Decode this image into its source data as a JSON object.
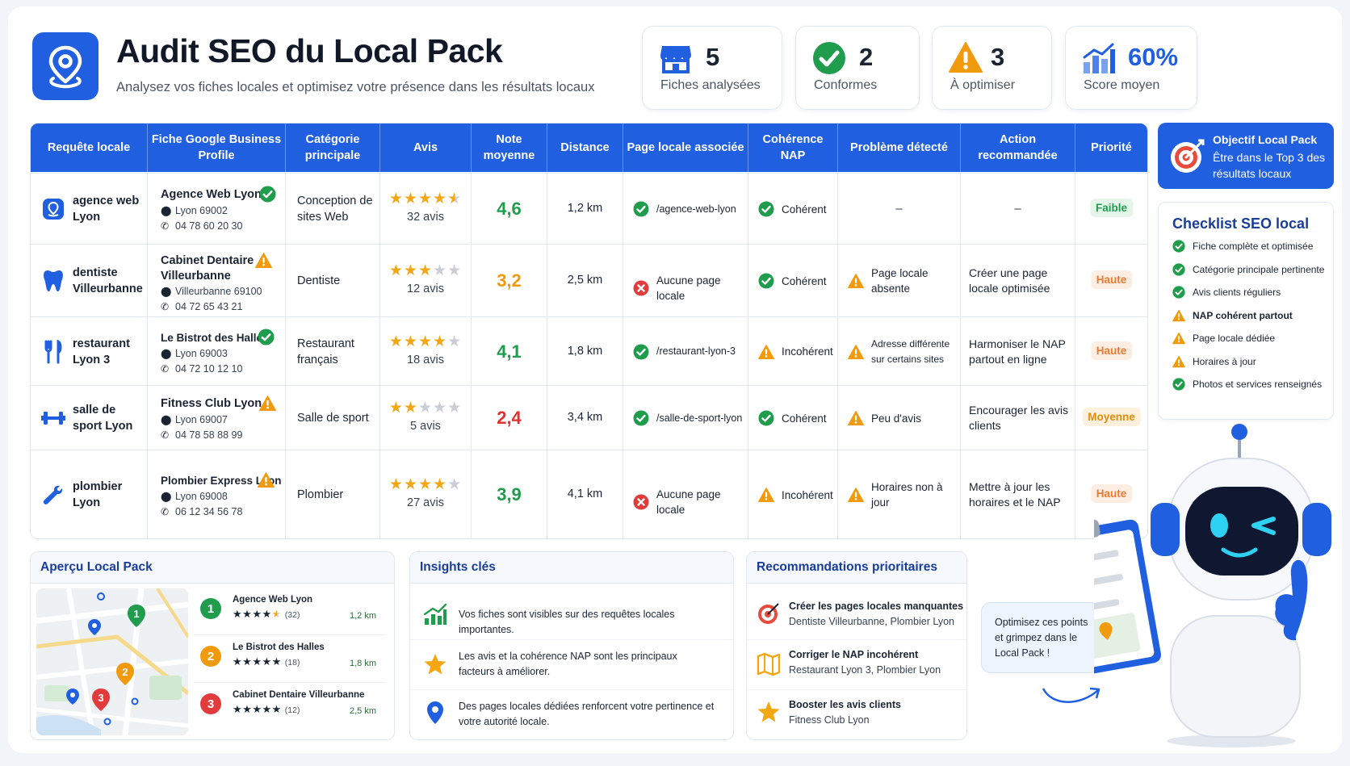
{
  "header": {
    "title": "Audit SEO du Local Pack",
    "subtitle": "Analysez vos fiches locales et optimisez votre présence dans les résultats locaux"
  },
  "kpis": [
    {
      "icon": "store-icon",
      "value": "5",
      "label": "Fiches analysées"
    },
    {
      "icon": "check-circle-icon",
      "value": "2",
      "label": "Conformes"
    },
    {
      "icon": "warning-icon",
      "value": "3",
      "label": "À optimiser"
    },
    {
      "icon": "bar-chart-icon",
      "value": "60%",
      "label": "Score moyen"
    }
  ],
  "table": {
    "headers": [
      "Requête locale",
      "Fiche Google Business Profile",
      "Catégorie principale",
      "Avis",
      "Note moyenne",
      "Distance",
      "Page locale associée",
      "Cohérence NAP",
      "Problème détecté",
      "Action recommandée",
      "Priorité"
    ],
    "rows": [
      {
        "query": "agence web Lyon",
        "query_icon": "location-badge-icon",
        "business": "Agence Web Lyon",
        "business_status": "ok",
        "city": "Lyon 69002",
        "phone": "04 78 60 20 30",
        "category": "Conception de sites Web",
        "rating_stars": 4.5,
        "reviews": "32 avis",
        "note": "4,6",
        "distance": "1,2 km",
        "page_status": "ok",
        "page": "/agence-web-lyon",
        "nap_status": "ok",
        "nap": "Cohérent",
        "problem_status": "none",
        "problem": "–",
        "action": "–",
        "priority": "Faible",
        "priority_level": "low"
      },
      {
        "query": "dentiste Villeurbanne",
        "query_icon": "tooth-icon",
        "business": "Cabinet Dentaire Villeurbanne",
        "business_status": "warn",
        "city": "Villeurbanne 69100",
        "phone": "04 72 65 43 21",
        "category": "Dentiste",
        "rating_stars": 3,
        "reviews": "12 avis",
        "note": "3,2",
        "distance": "2,5 km",
        "page_status": "error",
        "page": "Aucune page locale",
        "nap_status": "ok",
        "nap": "Cohérent",
        "problem_status": "warn",
        "problem": "Page locale absente",
        "action": "Créer une page locale optimisée",
        "priority": "Haute",
        "priority_level": "high"
      },
      {
        "query": "restaurant Lyon 3",
        "query_icon": "cutlery-icon",
        "business": "Le Bistrot des Halles",
        "business_status": "ok",
        "city": "Lyon 69003",
        "phone": "04 72 10 12 10",
        "category": "Restaurant français",
        "rating_stars": 4,
        "reviews": "18 avis",
        "note": "4,1",
        "distance": "1,8 km",
        "page_status": "ok",
        "page": "/restaurant-lyon-3",
        "nap_status": "warn",
        "nap": "Incohérent",
        "problem_status": "warn",
        "problem": "Adresse différente sur certains sites",
        "action": "Harmoniser le NAP partout en ligne",
        "priority": "Haute",
        "priority_level": "high"
      },
      {
        "query": "salle de sport Lyon",
        "query_icon": "dumbbell-icon",
        "business": "Fitness Club Lyon",
        "business_status": "warn",
        "city": "Lyon 69007",
        "phone": "04 78 58 88 99",
        "category": "Salle de sport",
        "rating_stars": 2,
        "reviews": "5 avis",
        "note": "2,4",
        "distance": "3,4 km",
        "page_status": "ok",
        "page": "/salle-de-sport-lyon",
        "nap_status": "ok",
        "nap": "Cohérent",
        "problem_status": "warn",
        "problem": "Peu d'avis",
        "action": "Encourager les avis clients",
        "priority": "Moyenne",
        "priority_level": "medium"
      },
      {
        "query": "plombier Lyon",
        "query_icon": "wrench-icon",
        "business": "Plombier Express Lyon",
        "business_status": "warn",
        "city": "Lyon 69008",
        "phone": "06 12 34 56 78",
        "category": "Plombier",
        "rating_stars": 4,
        "reviews": "27 avis",
        "note": "3,9",
        "distance": "4,1 km",
        "page_status": "error",
        "page": "Aucune page locale",
        "nap_status": "warn",
        "nap": "Incohérent",
        "problem_status": "warn",
        "problem": "Horaires non à jour",
        "action": "Mettre à jour les horaires et le NAP",
        "priority": "Haute",
        "priority_level": "high"
      }
    ]
  },
  "goal": {
    "title": "Objectif Local Pack",
    "text": "Être dans le Top 3 des résultats locaux"
  },
  "checklist": {
    "title": "Checklist SEO local",
    "items": [
      {
        "label": "Fiche complète et optimisée",
        "status": "ok"
      },
      {
        "label": "Catégorie principale pertinente",
        "status": "ok"
      },
      {
        "label": "Avis clients réguliers",
        "status": "ok"
      },
      {
        "label": "NAP cohérent partout",
        "status": "warn"
      },
      {
        "label": "Page locale dédiée",
        "status": "warn"
      },
      {
        "label": "Horaires à jour",
        "status": "warn"
      },
      {
        "label": "Photos et services renseignés",
        "status": "ok"
      }
    ]
  },
  "local_pack": {
    "title": "Aperçu Local Pack",
    "items": [
      {
        "rank": "1",
        "name": "Agence Web Lyon",
        "stars": 4.5,
        "count": "(32)",
        "distance": "1,2 km"
      },
      {
        "rank": "2",
        "name": "Le Bistrot des Halles",
        "stars": 4,
        "count": "(18)",
        "distance": "1,8 km"
      },
      {
        "rank": "3",
        "name": "Cabinet Dentaire Villeurbanne",
        "stars": 3,
        "count": "(12)",
        "distance": "2,5 km"
      }
    ]
  },
  "insights": {
    "title": "Insights clés",
    "items": [
      {
        "icon": "growth-chart-icon",
        "text": "Vos fiches sont visibles sur des requêtes locales importantes."
      },
      {
        "icon": "star-icon",
        "text": "Les avis et la cohérence NAP sont les principaux facteurs à améliorer."
      },
      {
        "icon": "map-pin-icon",
        "text": "Des pages locales dédiées renforcent votre pertinence et votre autorité locale."
      }
    ]
  },
  "recommendations": {
    "title": "Recommandations prioritaires",
    "items": [
      {
        "icon": "target-icon",
        "title": "Créer les pages locales manquantes",
        "sub": "Dentiste Villeurbanne, Plombier Lyon"
      },
      {
        "icon": "map-fold-icon",
        "title": "Corriger le NAP incohérent",
        "sub": "Restaurant Lyon 3, Plombier Lyon"
      },
      {
        "icon": "star-icon",
        "title": "Booster les avis clients",
        "sub": "Fitness Club Lyon"
      }
    ]
  },
  "mascot_bubble": "Optimisez ces points et grimpez dans le Local Pack !",
  "colors": {
    "primary": "#1f5fe0",
    "ok": "#1f9d4c",
    "warn": "#f29a0d",
    "error": "#e23b3b",
    "note_red": "#e0302f"
  }
}
